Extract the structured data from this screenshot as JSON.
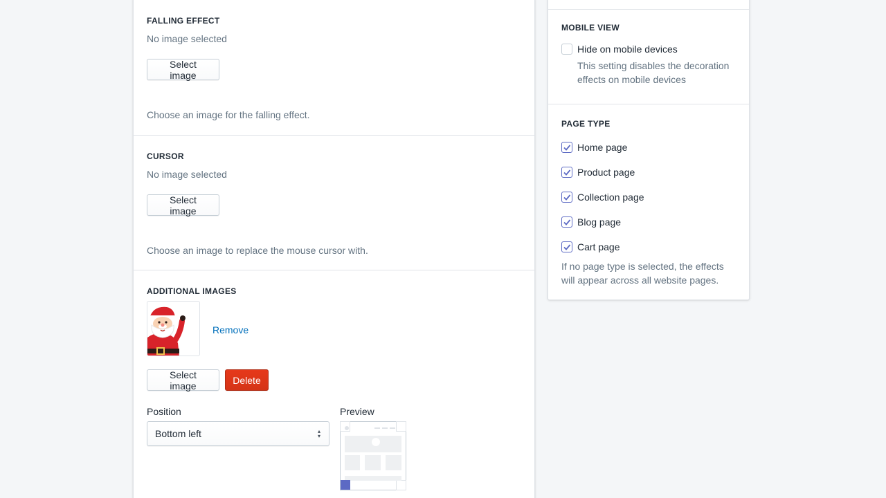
{
  "falling_effect": {
    "title": "FALLING EFFECT",
    "status": "No image selected",
    "select_label": "Select image",
    "help": "Choose an image for the falling effect."
  },
  "cursor": {
    "title": "CURSOR",
    "status": "No image selected",
    "select_label": "Select image",
    "help": "Choose an image to replace the mouse cursor with."
  },
  "additional_images": {
    "title": "ADDITIONAL IMAGES",
    "thumbnail_icon": "santa-image",
    "remove_label": "Remove",
    "select_label": "Select image",
    "delete_label": "Delete",
    "position_label": "Position",
    "position_value": "Bottom left",
    "preview_label": "Preview",
    "preview_highlight": "bottom-left"
  },
  "mobile_view": {
    "title": "MOBILE VIEW",
    "checkbox_label": "Hide on mobile devices",
    "checked": false,
    "help": "This setting disables the decoration effects on mobile devices"
  },
  "page_type": {
    "title": "PAGE TYPE",
    "items": [
      {
        "label": "Home page",
        "checked": true
      },
      {
        "label": "Product page",
        "checked": true
      },
      {
        "label": "Collection page",
        "checked": true
      },
      {
        "label": "Blog page",
        "checked": true
      },
      {
        "label": "Cart page",
        "checked": true
      }
    ],
    "help": "If no page type is selected, the effects will appear across all website pages."
  },
  "colors": {
    "accent": "#5c6ac4",
    "danger": "#de3618",
    "link": "#006fbb"
  }
}
